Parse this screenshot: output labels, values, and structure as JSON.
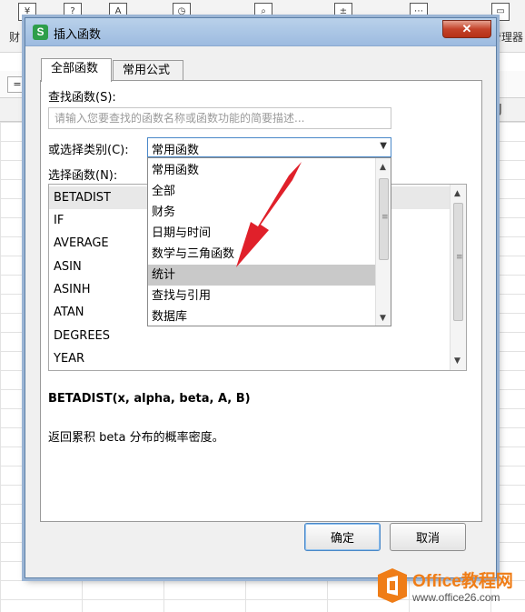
{
  "background": {
    "ribbon_labels": {
      "left": "财",
      "right": "管理器"
    },
    "ribbon_icons": [
      "¥",
      "?",
      "A",
      "clock-icon",
      "search-doc-icon",
      "math-icon",
      "more-icon",
      "doc-icon"
    ],
    "column_j": "J"
  },
  "dialog": {
    "title": "插入函数",
    "close_glyph": "✕",
    "tabs": [
      {
        "label": "全部函数",
        "active": true
      },
      {
        "label": "常用公式",
        "active": false
      }
    ],
    "search": {
      "label": "查找函数(S):",
      "placeholder": "请输入您要查找的函数名称或函数功能的简要描述...",
      "value": ""
    },
    "category": {
      "label": "或选择类别(C):",
      "selected": "常用函数",
      "options": [
        "常用函数",
        "全部",
        "财务",
        "日期与时间",
        "数学与三角函数",
        "统计",
        "查找与引用",
        "数据库"
      ],
      "highlighted": "统计"
    },
    "function_list": {
      "label": "选择函数(N):",
      "items": [
        "BETADIST",
        "IF",
        "AVERAGE",
        "ASIN",
        "ASINH",
        "ATAN",
        "DEGREES",
        "YEAR"
      ],
      "selected": "BETADIST"
    },
    "signature": "BETADIST(x, alpha, beta, A, B)",
    "description": "返回累积 beta 分布的概率密度。",
    "buttons": {
      "ok": "确定",
      "cancel": "取消"
    }
  },
  "watermark": {
    "brand_latin": "Office",
    "brand_cn": "教程网",
    "url": "www.office26.com"
  },
  "colors": {
    "arrow": "#e0202a",
    "select_border": "#4a88c8",
    "close_button": "#c4432a",
    "watermark_orange": "#ef7d17"
  }
}
